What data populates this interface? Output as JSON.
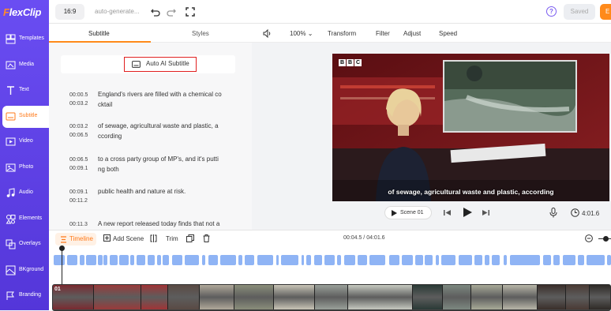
{
  "app": {
    "logo_prefix": "F",
    "logo_rest": "lexClip"
  },
  "sidebar": {
    "items": [
      {
        "label": "Templates",
        "icon": "templates-icon"
      },
      {
        "label": "Media",
        "icon": "media-icon"
      },
      {
        "label": "Text",
        "icon": "text-icon"
      },
      {
        "label": "Subtitle",
        "icon": "subtitle-icon"
      },
      {
        "label": "Video",
        "icon": "video-icon"
      },
      {
        "label": "Photo",
        "icon": "photo-icon"
      },
      {
        "label": "Audio",
        "icon": "audio-icon"
      },
      {
        "label": "Elements",
        "icon": "elements-icon"
      },
      {
        "label": "Overlays",
        "icon": "overlays-icon"
      },
      {
        "label": "BKground",
        "icon": "background-icon"
      },
      {
        "label": "Branding",
        "icon": "branding-icon"
      }
    ],
    "active": "Subtitle"
  },
  "topbar": {
    "ratio": "16:9",
    "project_name": "auto-generate...",
    "help": "?",
    "saved": "Saved",
    "export_partial": "E"
  },
  "panel": {
    "tabs": [
      "Subtitle",
      "Styles"
    ],
    "auto_button": "Auto AI Subtitle",
    "subtitles": [
      {
        "start": "00:00.5",
        "end": "00:03.2",
        "text": "England's rivers are filled with a chemical co cktail"
      },
      {
        "start": "00:03.2",
        "end": "00:06.5",
        "text": "of sewage, agricultural waste and plastic, a ccording"
      },
      {
        "start": "00:06.5",
        "end": "00:09.1",
        "text": "to a cross party group of MP's, and it's putti ng both"
      },
      {
        "start": "00:09.1",
        "end": "00:11.2",
        "text": "public health and nature at risk."
      },
      {
        "start": "00:11.3",
        "end": "",
        "text": "A new report released today finds that not a"
      }
    ]
  },
  "preview": {
    "zoom": "100%",
    "tools": [
      "Transform",
      "Filter",
      "Adjust",
      "Speed"
    ],
    "caption": "of sewage, agricultural waste and plastic, according",
    "bbc": [
      "B",
      "B",
      "C"
    ],
    "scene_label": "Scene 01",
    "duration": "4:01.6"
  },
  "timeline": {
    "label": "Timeline",
    "add_scene": "Add Scene",
    "trim": "Trim",
    "timecode": "00:04.5 / 04:01.6",
    "clip_label": "01"
  },
  "colors": {
    "accent": "#ff8a1a",
    "sidebar": "#5b3ee0",
    "subtitle_segment": "#8fb4f5"
  }
}
